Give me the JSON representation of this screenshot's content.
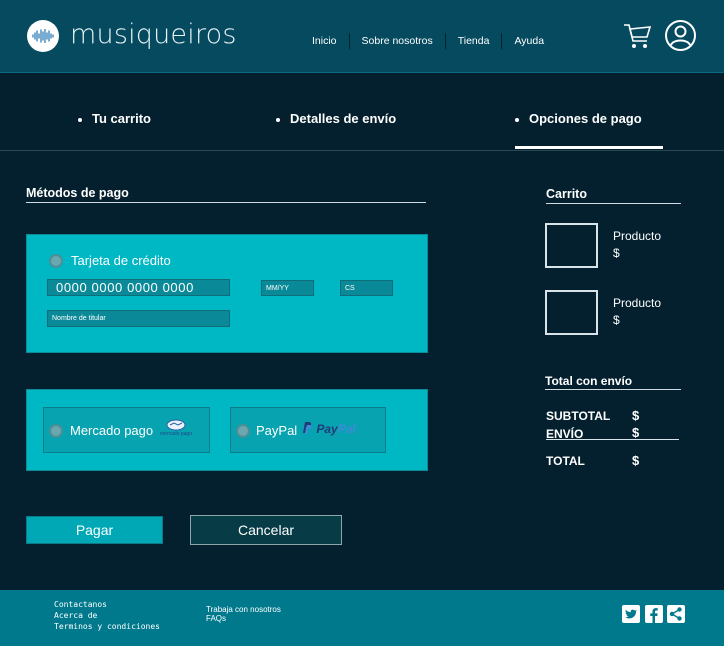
{
  "header": {
    "brand": "musiqueiros",
    "nav": [
      "Inicio",
      "Sobre nosotros",
      "Tienda",
      "Ayuda"
    ]
  },
  "steps": {
    "cart": "Tu carrito",
    "shipping": "Detalles de envío",
    "payment": "Opciones de pago"
  },
  "payment_methods": {
    "title": "Métodos de pago",
    "credit_card_label": "Tarjeta de crédito",
    "card_number": "0000 0000 0000 0000",
    "expiry_placeholder": "MM/YY",
    "cvv_placeholder": "CS",
    "holder_placeholder": "Nombre de titular",
    "mercadopago_label": "Mercado pago",
    "mercadopago_logo_text": "mercado pago",
    "paypal_label": "PayPal",
    "paypal_logo_pay": "Pay",
    "paypal_logo_pal": "Pal"
  },
  "actions": {
    "pay": "Pagar",
    "cancel": "Cancelar"
  },
  "cart": {
    "title": "Carrito",
    "items": [
      {
        "name": "Producto",
        "price": "$"
      },
      {
        "name": "Producto",
        "price": "$"
      }
    ],
    "totals_title": "Total con envío",
    "subtotal_label": "SUBTOTAL",
    "subtotal_value": "$",
    "shipping_label": "ENVÍO",
    "shipping_value": "$",
    "total_label": "TOTAL",
    "total_value": "$"
  },
  "footer": {
    "col1": [
      "Contactanos",
      "Acerca de",
      "Terminos y condiciones"
    ],
    "col2": [
      "Trabaja con nosotros",
      "FAQs"
    ]
  },
  "colors": {
    "background": "#04202e",
    "header": "#064a5f",
    "panel": "#00b7c4",
    "footer": "#00798d"
  },
  "icons": [
    "waveform-logo-icon",
    "shopping-cart-icon",
    "user-account-icon",
    "twitter-icon",
    "facebook-icon",
    "share-icon",
    "mercadopago-logo-icon",
    "paypal-p-icon"
  ]
}
